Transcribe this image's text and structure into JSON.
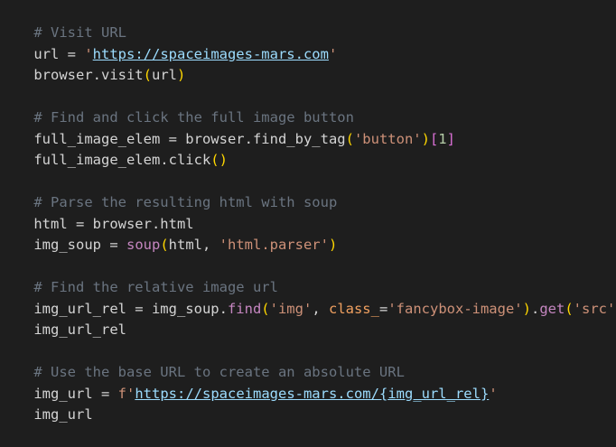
{
  "code": {
    "l1": {
      "c": "# Visit URL"
    },
    "l2": {
      "a": "url = ",
      "q1": "'",
      "u": "https://spaceimages-mars.com",
      "q2": "'"
    },
    "l3": {
      "a": "browser.visit",
      "p1": "(",
      "b": "url",
      "p2": ")"
    },
    "l5": {
      "c": "# Find and click the full image button"
    },
    "l6": {
      "a": "full_image_elem = browser.find_by_tag",
      "p1": "(",
      "s": "'button'",
      "p2": ")",
      "i1": "[",
      "n": "1",
      "i2": "]"
    },
    "l7": {
      "a": "full_image_elem.click",
      "p": "()"
    },
    "l9": {
      "c": "# Parse the resulting html with soup"
    },
    "l10": {
      "a": "html = browser.html"
    },
    "l11": {
      "a": "img_soup = ",
      "f": "soup",
      "p1": "(",
      "b": "html, ",
      "s": "'html.parser'",
      "p2": ")"
    },
    "l13": {
      "c": "# Find the relative image url"
    },
    "l14": {
      "a": "img_url_rel = img_soup.",
      "f1": "find",
      "p1": "(",
      "s1": "'img'",
      "b": ", ",
      "k": "class_",
      "e": "=",
      "s2": "'fancybox-image'",
      "p2": ")",
      "d": ".",
      "f2": "get",
      "p3": "(",
      "s3": "'src'",
      "p4": ")"
    },
    "l15": {
      "a": "img_url_rel"
    },
    "l17": {
      "c": "# Use the base URL to create an absolute URL"
    },
    "l18": {
      "a": "img_url = ",
      "f": "f",
      "q1": "'",
      "u": "https://spaceimages-mars.com/",
      "c1": "{",
      "v": "img_url_rel",
      "c2": "}",
      "q2": "'"
    },
    "l19": {
      "a": "img_url"
    }
  },
  "colors": {
    "background": "#1e1e1e",
    "comment": "#6a7480",
    "string": "#ce9178",
    "function": "#dcdcaa",
    "bracket": "#ffd700"
  }
}
